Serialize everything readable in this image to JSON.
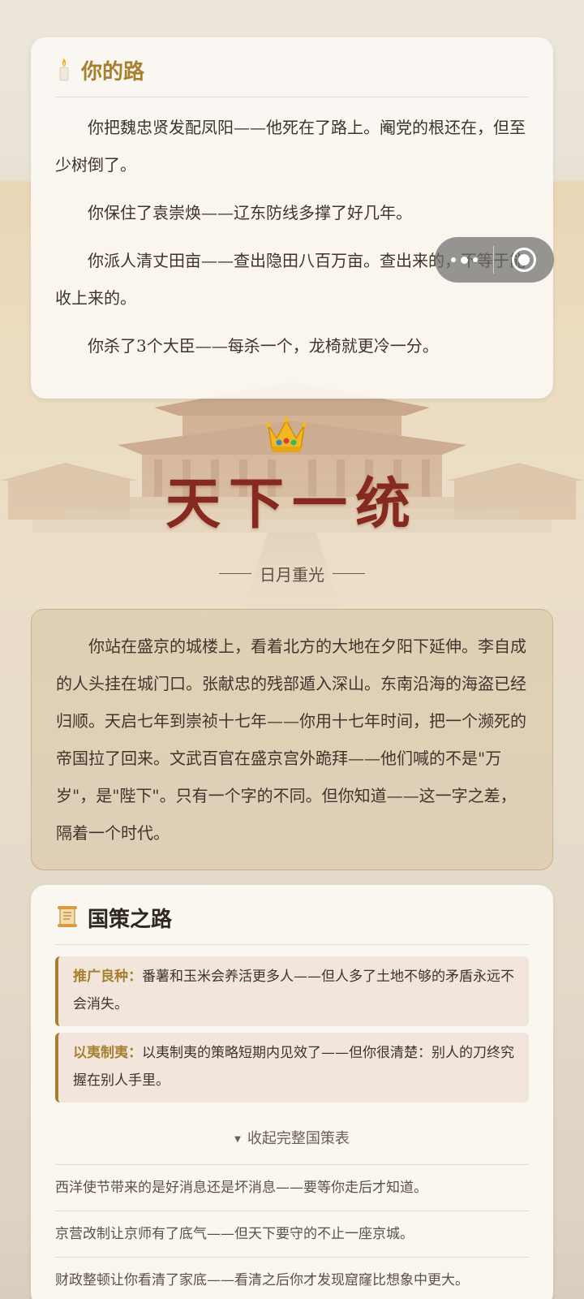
{
  "path_card": {
    "title": "你的路",
    "icon": "candle-icon",
    "paragraphs": [
      "你把魏忠贤发配凤阳——他死在了路上。阉党的根还在，但至少树倒了。",
      "你保住了袁崇焕——辽东防线多撑了好几年。",
      "你派人清丈田亩——查出隐田八百万亩。查出来的，不等于能收上来的。",
      "你杀了3个大臣——每杀一个，龙椅就更冷一分。"
    ]
  },
  "ending": {
    "crown_icon": "crown-icon",
    "title": "天下一统",
    "subtitle": "日月重光"
  },
  "narrative": {
    "text": "你站在盛京的城楼上，看着北方的大地在夕阳下延伸。李自成的人头挂在城门口。张献忠的残部遁入深山。东南沿海的海盗已经归顺。天启七年到崇祯十七年——你用十七年时间，把一个濒死的帝国拉了回来。文武百官在盛京宫外跪拜——他们喊的不是\"万岁\"，是\"陛下\"。只有一个字的不同。但你知道——这一字之差，隔着一个时代。"
  },
  "policy_card": {
    "title": "国策之路",
    "icon": "scroll-icon",
    "highlights": [
      {
        "tag": "推广良种：",
        "text": "番薯和玉米会养活更多人——但人多了土地不够的矛盾永远不会消失。"
      },
      {
        "tag": "以夷制夷：",
        "text": "以夷制夷的策略短期内见效了——但你很清楚：别人的刀终究握在别人手里。"
      }
    ],
    "toggle_label": "收起完整国策表",
    "rows": [
      "西洋使节带来的是好消息还是坏消息——要等你走后才知道。",
      "京营改制让京师有了底气——但天下要守的不止一座京城。",
      "财政整顿让你看清了家底——看清之后你才发现窟窿比想象中更大。"
    ]
  },
  "capsule": {
    "more_icon": "more-dots-icon",
    "close_icon": "close-target-icon"
  }
}
